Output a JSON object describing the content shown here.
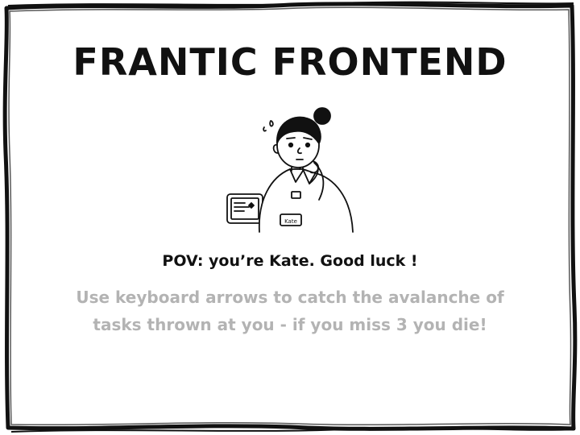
{
  "game": {
    "title": "FRANTIC FRONTEND",
    "pov_text": "POV: you’re Kate. Good luck !",
    "instructions": "Use keyboard arrows to catch the avalanche of tasks thrown at you - if you miss 3 you die!",
    "character_name": "Kate"
  },
  "colors": {
    "ink": "#111111",
    "muted_text": "#b3b3b3",
    "background": "#ffffff"
  },
  "icons": {
    "character": "thinking-woman-illustration",
    "device": "tablet-icon"
  }
}
